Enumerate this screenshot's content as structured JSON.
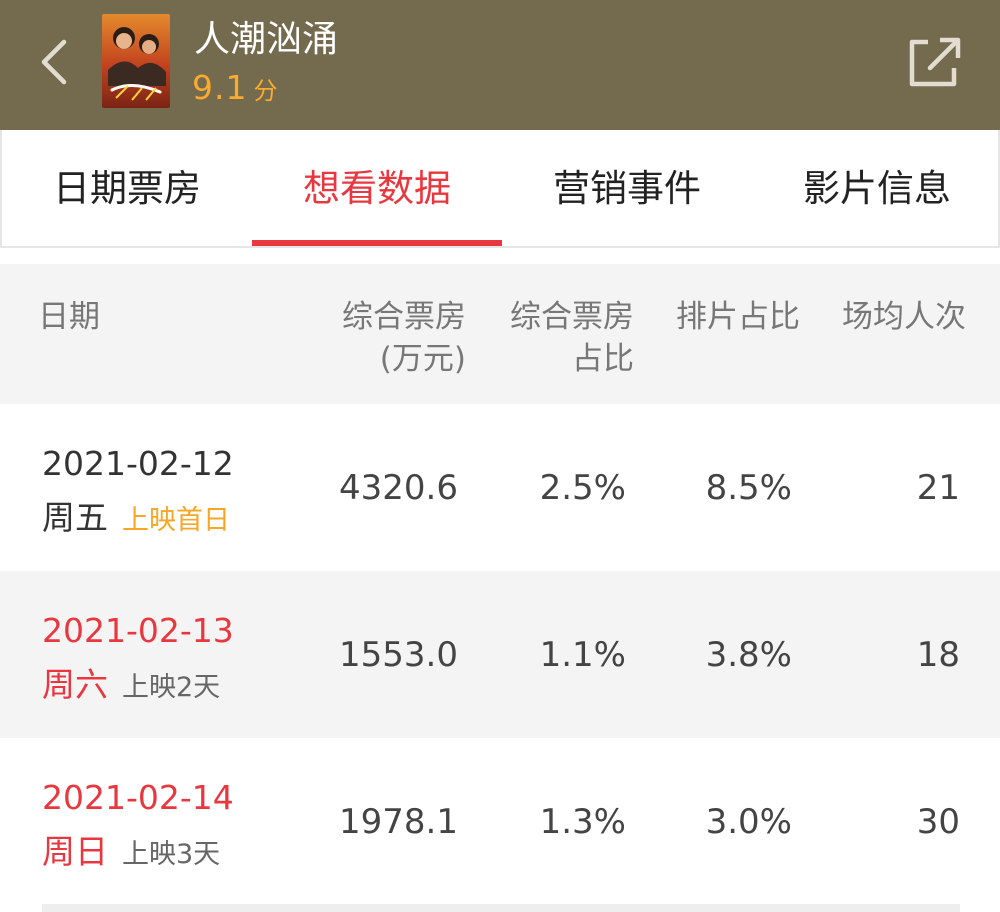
{
  "header": {
    "movie_title": "人潮汹涌",
    "score": "9.1",
    "score_unit": "分",
    "poster_text": "人潮汹涌"
  },
  "tabs": [
    {
      "label": "日期票房",
      "active": false
    },
    {
      "label": "想看数据",
      "active": true
    },
    {
      "label": "营销事件",
      "active": false
    },
    {
      "label": "影片信息",
      "active": false
    }
  ],
  "table": {
    "headers": {
      "date": "日期",
      "box_office_line1": "综合票房",
      "box_office_line2": "(万元)",
      "share_line1": "综合票房",
      "share_line2": "占比",
      "schedule": "排片占比",
      "avg_viewers": "场均人次"
    },
    "rows": [
      {
        "date": "2021-02-12",
        "weekday": "周五",
        "days": "上映首日",
        "box_office": "4320.6",
        "share": "2.5%",
        "schedule": "8.5%",
        "avg": "21",
        "weekend": false
      },
      {
        "date": "2021-02-13",
        "weekday": "周六",
        "days": "上映2天",
        "box_office": "1553.0",
        "share": "1.1%",
        "schedule": "3.8%",
        "avg": "18",
        "weekend": true
      },
      {
        "date": "2021-02-14",
        "weekday": "周日",
        "days": "上映3天",
        "box_office": "1978.1",
        "share": "1.3%",
        "schedule": "3.0%",
        "avg": "30",
        "weekend": true
      }
    ]
  },
  "colors": {
    "header_bg": "#746a4e",
    "accent_red": "#e8373f",
    "score_orange": "#f8ab2e",
    "first_day_orange": "#f8a625"
  },
  "icons": [
    "back-chevron-icon",
    "share-icon"
  ]
}
